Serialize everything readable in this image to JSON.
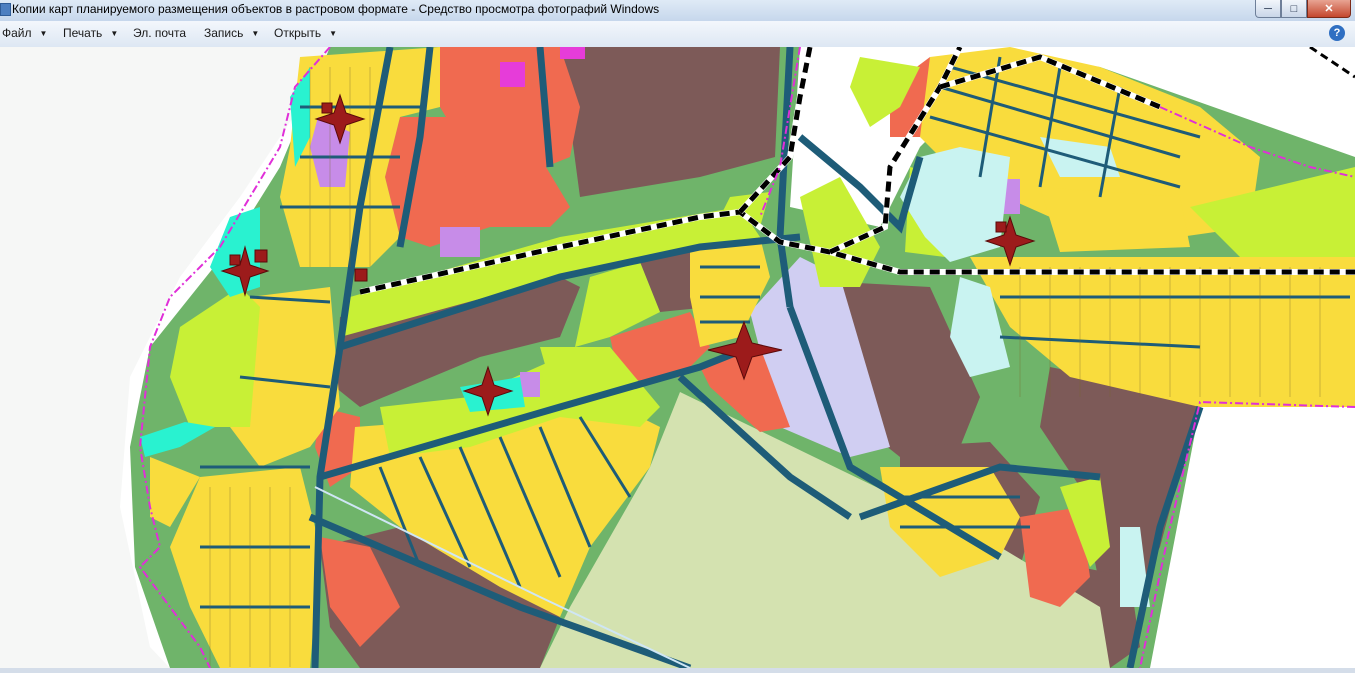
{
  "window": {
    "title": "Копии карт планируемого размещения объектов в растровом формате - Средство просмотра фотографий Windows",
    "minimize_icon": "minimize-icon",
    "maximize_icon": "maximize-icon",
    "close_icon": "close-icon"
  },
  "menu": {
    "items": [
      {
        "label": "Файл",
        "dropdown": true
      },
      {
        "label": "Печать",
        "dropdown": true
      },
      {
        "label": "Эл. почта",
        "dropdown": false
      },
      {
        "label": "Запись",
        "dropdown": true
      },
      {
        "label": "Открыть",
        "dropdown": true
      }
    ],
    "help": "?"
  },
  "map": {
    "image": "urban-planning-zoning-map",
    "colors": {
      "residential_individual": "#f9dc3d",
      "residential_low": "#c8f036",
      "public_business": "#f06a50",
      "industrial": "#7d5a58",
      "recreation": "#d4e2b0",
      "social": "#c78ce8",
      "green": "#6fb46a",
      "water": "#c9f3f1",
      "roads": "#1e5c78",
      "boundary": "#e02fd8",
      "railway": "#000000",
      "warehouse": "#d0cef2",
      "marker": "#9c1b1b"
    }
  }
}
